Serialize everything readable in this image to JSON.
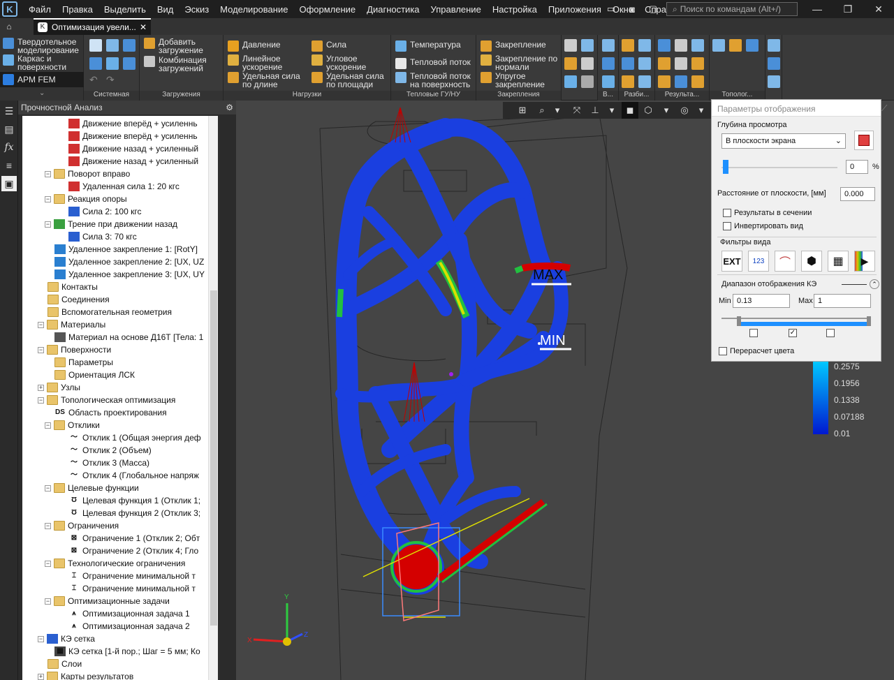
{
  "menu": {
    "items": [
      "Файл",
      "Правка",
      "Выделить",
      "Вид",
      "Эскиз",
      "Моделирование",
      "Оформление",
      "Диагностика",
      "Управление",
      "Настройка",
      "Приложения",
      "Окно",
      "Справка"
    ],
    "search_placeholder": "Поиск по командам (Alt+/)"
  },
  "tab": {
    "title": "Оптимизация увели...",
    "close": "✕"
  },
  "ribbon": {
    "left": {
      "solid": "Твердотельное моделирование",
      "frame": "Каркас и поверхности",
      "apm": "APM FEM"
    },
    "system_label": "Системная",
    "loads_group": {
      "add": "Добавить загружение",
      "combo": "Комбинация загружений",
      "label": "Загружения"
    },
    "forces": {
      "pressure": "Давление",
      "linacc": "Линейное ускорение",
      "linweight": "Удельная сила по длине",
      "force": "Сила",
      "angacc": "Угловое ускорение",
      "areaweight": "Удельная сила по площади",
      "label": "Нагрузки"
    },
    "thermal": {
      "temp": "Температура",
      "flux": "Тепловой поток",
      "fluxsurf": "Тепловой поток на поверхность",
      "label": "Тепловые ГУ/НУ"
    },
    "fix": {
      "fix": "Закрепление",
      "normal": "Закрепление по нормали",
      "elastic": "Упругое закрепление",
      "label": "Закрепления"
    },
    "small_labels": [
      "В...",
      "Разби...",
      "Результа...",
      "Тополог..."
    ]
  },
  "panel": {
    "title": "Прочностной Анализ"
  },
  "tree": [
    {
      "t": "Движение вперёд + усиленнь",
      "lvl": 4,
      "ic": "load"
    },
    {
      "t": "Движение вперёд + усиленнь",
      "lvl": 4,
      "ic": "load"
    },
    {
      "t": "Движение назад + усиленный",
      "lvl": 4,
      "ic": "load"
    },
    {
      "t": "Движение назад + усиленный",
      "lvl": 4,
      "ic": "load"
    },
    {
      "t": "Поворот вправо",
      "lvl": 3,
      "ic": "folder",
      "exp": "−"
    },
    {
      "t": "Удаленная сила 1: 20 кгс",
      "lvl": 4,
      "ic": "force"
    },
    {
      "t": "Реакция опоры",
      "lvl": 3,
      "ic": "folder",
      "exp": "−"
    },
    {
      "t": "Сила 2: 100 кгс",
      "lvl": 4,
      "ic": "force2"
    },
    {
      "t": "Трение при движении назад",
      "lvl": 3,
      "ic": "fric",
      "exp": "−"
    },
    {
      "t": "Сила 3: 70 кгс",
      "lvl": 4,
      "ic": "force2"
    },
    {
      "t": "Удаленное закрепление 1: [RotY]",
      "lvl": 3,
      "ic": "fix"
    },
    {
      "t": "Удаленное закрепление 2: [UX, UZ",
      "lvl": 3,
      "ic": "fix"
    },
    {
      "t": "Удаленное закрепление 3: [UX, UY",
      "lvl": 3,
      "ic": "fix"
    },
    {
      "t": "Контакты",
      "lvl": 2,
      "ic": "folder"
    },
    {
      "t": "Соединения",
      "lvl": 2,
      "ic": "folder"
    },
    {
      "t": "Вспомогательная геометрия",
      "lvl": 2,
      "ic": "folder"
    },
    {
      "t": "Материалы",
      "lvl": 2,
      "ic": "folder",
      "exp": "−"
    },
    {
      "t": "Материал на основе Д16Т [Тела: 1",
      "lvl": 3,
      "ic": "mat"
    },
    {
      "t": "Поверхности",
      "lvl": 2,
      "ic": "folder",
      "exp": "−"
    },
    {
      "t": "Параметры",
      "lvl": 3,
      "ic": "folder"
    },
    {
      "t": "Ориентация ЛСК",
      "lvl": 3,
      "ic": "folder"
    },
    {
      "t": "Узлы",
      "lvl": 2,
      "ic": "folder",
      "exp": "+"
    },
    {
      "t": "Топологическая оптимизация",
      "lvl": 2,
      "ic": "folder",
      "exp": "−"
    },
    {
      "t": "Область проектирования",
      "lvl": 3,
      "ic": "ds"
    },
    {
      "t": "Отклики",
      "lvl": 3,
      "ic": "folder",
      "exp": "−"
    },
    {
      "t": "Отклик 1 (Общая энергия деф",
      "lvl": 4,
      "ic": "resp"
    },
    {
      "t": "Отклик 2 (Объем)",
      "lvl": 4,
      "ic": "resp"
    },
    {
      "t": "Отклик 3 (Масса)",
      "lvl": 4,
      "ic": "resp"
    },
    {
      "t": "Отклик 4 (Глобальное напряж",
      "lvl": 4,
      "ic": "resp"
    },
    {
      "t": "Целевые функции",
      "lvl": 3,
      "ic": "folder",
      "exp": "−"
    },
    {
      "t": "Целевая функция 1 (Отклик 1;",
      "lvl": 4,
      "ic": "goal"
    },
    {
      "t": "Целевая функция 2 (Отклик 3;",
      "lvl": 4,
      "ic": "goal"
    },
    {
      "t": "Ограничения",
      "lvl": 3,
      "ic": "folder",
      "exp": "−"
    },
    {
      "t": "Ограничение 1 (Отклик 2; Обт",
      "lvl": 4,
      "ic": "lim"
    },
    {
      "t": "Ограничение 2 (Отклик 4; Гло",
      "lvl": 4,
      "ic": "lim"
    },
    {
      "t": "Технологические ограничения",
      "lvl": 3,
      "ic": "folder",
      "exp": "−"
    },
    {
      "t": "Ограничение минимальной т",
      "lvl": 4,
      "ic": "tlim"
    },
    {
      "t": "Ограничение минимальной т",
      "lvl": 4,
      "ic": "tlim"
    },
    {
      "t": "Оптимизационные задачи",
      "lvl": 3,
      "ic": "folder",
      "exp": "−"
    },
    {
      "t": "Оптимизационная задача 1",
      "lvl": 4,
      "ic": "task"
    },
    {
      "t": "Оптимизационная задача 2",
      "lvl": 4,
      "ic": "task"
    },
    {
      "t": "КЭ сетка",
      "lvl": 2,
      "ic": "mesh",
      "exp": "−"
    },
    {
      "t": "КЭ сетка [1-й пор.; Шаг = 5 мм; Ко",
      "lvl": 3,
      "ic": "mesh2"
    },
    {
      "t": "Слои",
      "lvl": 2,
      "ic": "folder"
    },
    {
      "t": "Карты результатов",
      "lvl": 2,
      "ic": "folder",
      "exp": "+"
    }
  ],
  "viewport": {
    "max_label": "MAX",
    "min_label": "MIN"
  },
  "props": {
    "title": "Параметры отображения",
    "depth_label": "Глубина просмотра",
    "depth_value": "В плоскости экрана",
    "slider_value": "0",
    "pct": "%",
    "distance_label": "Расстояние от плоскости, [мм]",
    "distance_value": "0.000",
    "section_label": "Результаты в сечении",
    "invert_label": "Инвертировать вид",
    "filters_label": "Фильтры вида",
    "filter_ext": "EXT",
    "filter_123": "123",
    "range_label": "Диапазон отображения КЭ",
    "min_label": "Min",
    "min_value": "0.13",
    "max_label": "Max",
    "max_value": "1",
    "recalc_label": "Перерасчет цвета"
  },
  "legend": {
    "values": [
      "0.2575",
      "0.1956",
      "0.1338",
      "0.07188",
      "0.01"
    ]
  },
  "colors": {
    "menubar": "#1f1f1f",
    "ribbon": "#3a3a3a",
    "viewport": "#454545",
    "accent": "#1e90ff",
    "blue": "#0a2fd6",
    "max": "#d40000"
  }
}
